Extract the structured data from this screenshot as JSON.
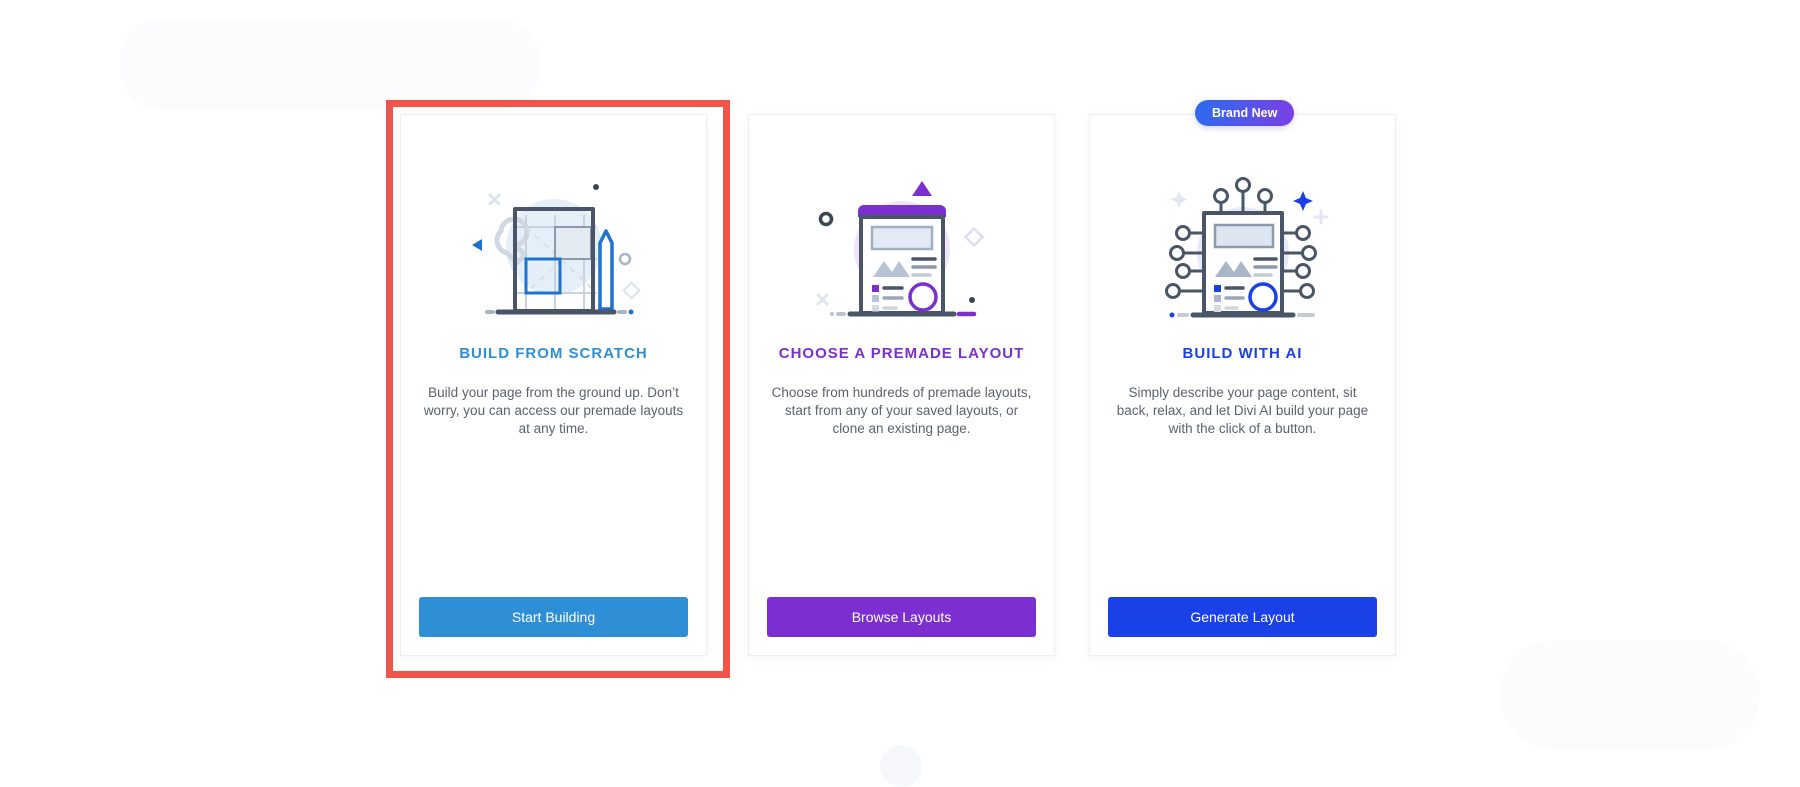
{
  "page": {
    "background_color": "#ffffff",
    "highlight_color": "#F0554C"
  },
  "badge": {
    "label": "Brand New",
    "gradient_from": "#2B6CF0",
    "gradient_to": "#7B3FE4"
  },
  "cards": [
    {
      "id": "build-from-scratch",
      "title": "BUILD FROM SCRATCH",
      "title_color": "#2E8FD6",
      "description": "Build your page from the ground up. Don’t worry, you can access our premade layouts at any time.",
      "button_label": "Start Building",
      "button_color": "#2E8FD6",
      "illustration": "blueprint-wireframe-icon",
      "selected": true
    },
    {
      "id": "choose-premade-layout",
      "title": "CHOOSE A PREMADE LAYOUT",
      "title_color": "#7B2FD0",
      "description": "Choose from hundreds of premade layouts, start from any of your saved layouts, or clone an existing page.",
      "button_label": "Browse Layouts",
      "button_color": "#7B2FD0",
      "illustration": "layout-page-icon",
      "selected": false
    },
    {
      "id": "build-with-ai",
      "title": "BUILD WITH AI",
      "title_color": "#1A41E8",
      "description": "Simply describe your page content, sit back, relax, and let Divi AI build your page with the click of a button.",
      "button_label": "Generate Layout",
      "button_color": "#1A41E8",
      "illustration": "ai-circuit-page-icon",
      "selected": false
    }
  ]
}
